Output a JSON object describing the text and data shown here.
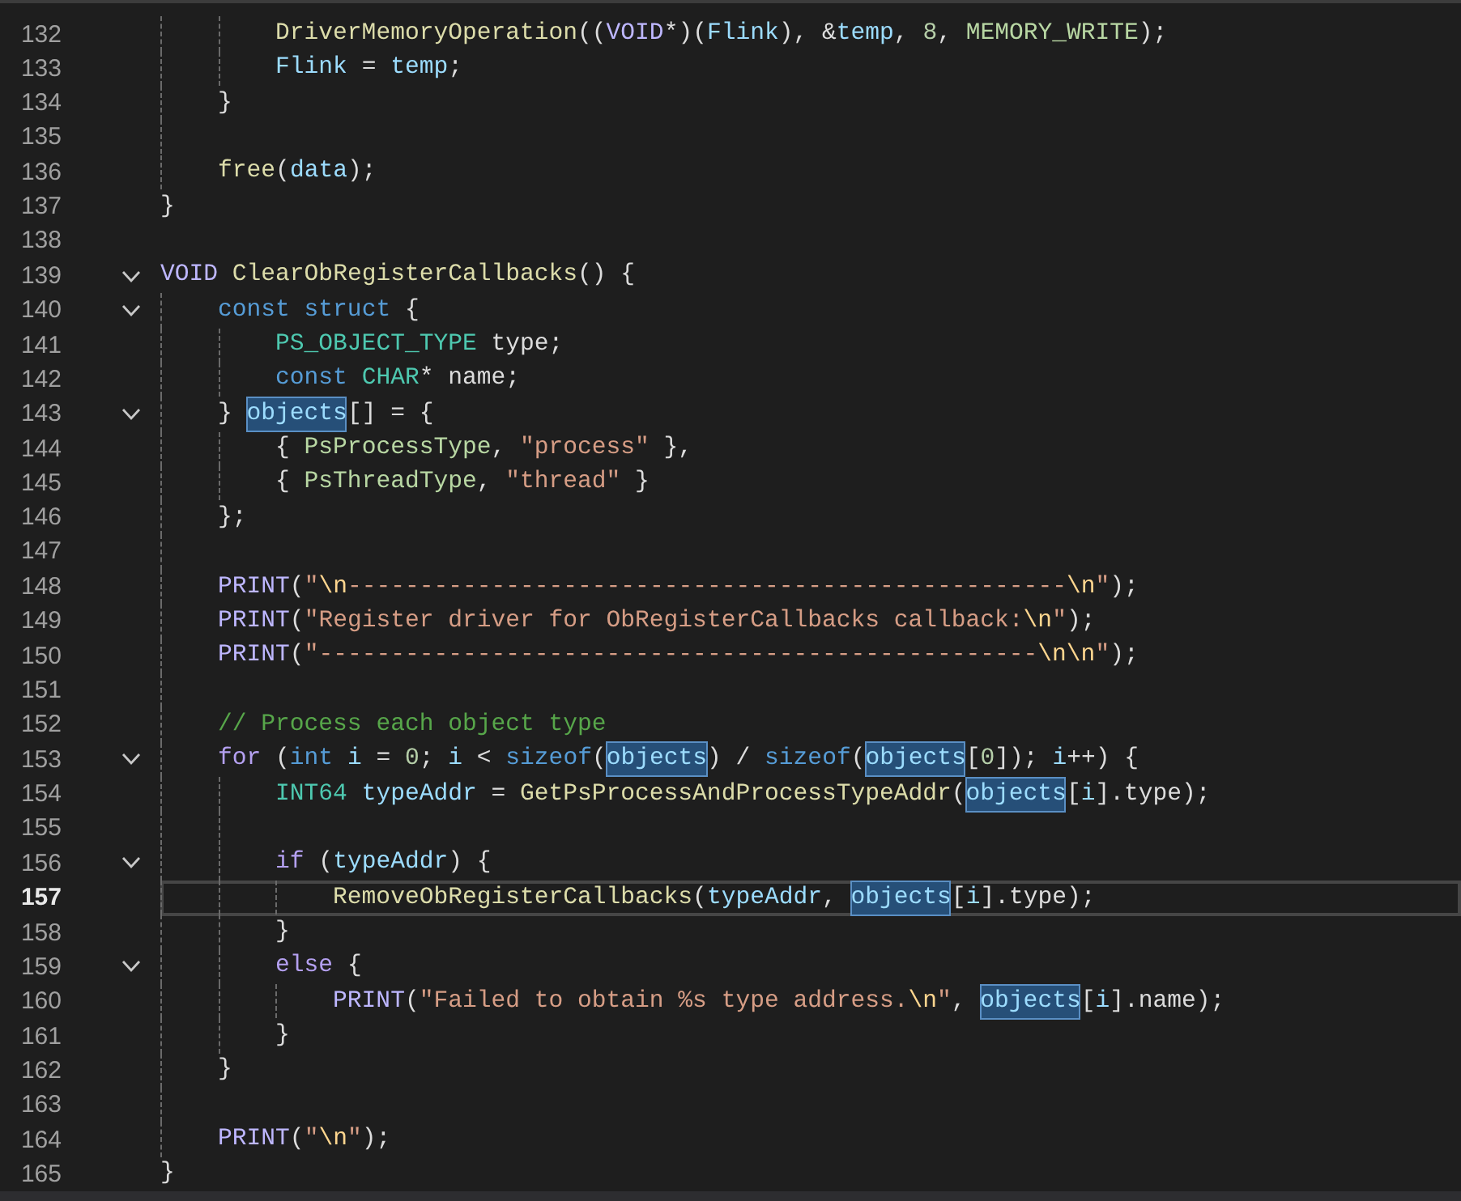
{
  "editor": {
    "lines": [
      {
        "children": [
          {
            "children": [
              {
                "number": "132",
                "fold": false,
                "current": false,
                "tokens": [
                  {
                    "kind": "f",
                    "text": "DriverMemoryOperation"
                  },
                  {
                    "kind": "p",
                    "text": "(("
                  },
                  {
                    "kind": "m",
                    "text": "VOID"
                  },
                  {
                    "kind": "p",
                    "text": "*)("
                  },
                  {
                    "kind": "v",
                    "text": "Flink"
                  },
                  {
                    "kind": "p",
                    "text": "), &"
                  },
                  {
                    "kind": "v",
                    "text": "temp"
                  },
                  {
                    "kind": "p",
                    "text": ", "
                  },
                  {
                    "kind": "n",
                    "text": "8"
                  },
                  {
                    "kind": "p",
                    "text": ", "
                  },
                  {
                    "kind": "en",
                    "text": "MEMORY_WRITE"
                  },
                  {
                    "kind": "p",
                    "text": ");"
                  }
                ]
              },
              {
                "number": "133",
                "fold": false,
                "current": false,
                "tokens": [
                  {
                    "kind": "v",
                    "text": "Flink"
                  },
                  {
                    "kind": "p",
                    "text": " = "
                  },
                  {
                    "kind": "v",
                    "text": "temp"
                  },
                  {
                    "kind": "p",
                    "text": ";"
                  }
                ]
              }
            ]
          },
          {
            "number": "134",
            "fold": false,
            "current": false,
            "tokens": [
              {
                "kind": "p",
                "text": "}"
              }
            ]
          },
          {
            "number": "135",
            "fold": false,
            "current": false
          },
          {
            "number": "136",
            "fold": false,
            "current": false,
            "tokens": [
              {
                "kind": "f",
                "text": "free"
              },
              {
                "kind": "p",
                "text": "("
              },
              {
                "kind": "v",
                "text": "data"
              },
              {
                "kind": "p",
                "text": ");"
              }
            ]
          }
        ]
      },
      {
        "number": "137",
        "fold": false,
        "current": false,
        "tokens": [
          {
            "kind": "p",
            "text": "}"
          }
        ]
      },
      {
        "number": "138",
        "fold": false,
        "current": false
      },
      {
        "number": "139",
        "fold": true,
        "current": false,
        "tokens": [
          {
            "kind": "m",
            "text": "VOID "
          },
          {
            "kind": "f",
            "text": "ClearObRegisterCallbacks"
          },
          {
            "kind": "p",
            "text": "() {"
          }
        ],
        "children": [
          {
            "number": "140",
            "fold": true,
            "current": false,
            "tokens": [
              {
                "kind": "k",
                "text": "const "
              },
              {
                "kind": "k",
                "text": "struct"
              },
              {
                "kind": "p",
                "text": " {"
              }
            ],
            "children": [
              {
                "number": "141",
                "fold": false,
                "current": false,
                "tokens": [
                  {
                    "kind": "t",
                    "text": "PS_OBJECT_TYPE"
                  },
                  {
                    "kind": "p",
                    "text": " type;"
                  }
                ]
              },
              {
                "number": "142",
                "fold": false,
                "current": false,
                "tokens": [
                  {
                    "kind": "k",
                    "text": "const "
                  },
                  {
                    "kind": "t",
                    "text": "CHAR"
                  },
                  {
                    "kind": "p",
                    "text": "* name;"
                  }
                ]
              }
            ]
          },
          {
            "number": "143",
            "fold": true,
            "current": false,
            "tokens": [
              {
                "kind": "p",
                "text": "} "
              },
              {
                "kind": "r",
                "text": "objects"
              },
              {
                "kind": "p",
                "text": "[] = {"
              }
            ],
            "children": [
              {
                "number": "144",
                "fold": false,
                "current": false,
                "tokens": [
                  {
                    "kind": "p",
                    "text": "{ "
                  },
                  {
                    "kind": "en",
                    "text": "PsProcessType"
                  },
                  {
                    "kind": "p",
                    "text": ", "
                  },
                  {
                    "kind": "s",
                    "text": "\"process\""
                  },
                  {
                    "kind": "p",
                    "text": " },"
                  }
                ]
              },
              {
                "number": "145",
                "fold": false,
                "current": false,
                "tokens": [
                  {
                    "kind": "p",
                    "text": "{ "
                  },
                  {
                    "kind": "en",
                    "text": "PsThreadType"
                  },
                  {
                    "kind": "p",
                    "text": ", "
                  },
                  {
                    "kind": "s",
                    "text": "\"thread\""
                  },
                  {
                    "kind": "p",
                    "text": " }"
                  }
                ]
              }
            ]
          },
          {
            "number": "146",
            "fold": false,
            "current": false,
            "tokens": [
              {
                "kind": "p",
                "text": "};"
              }
            ]
          },
          {
            "number": "147",
            "fold": false,
            "current": false
          },
          {
            "number": "148",
            "fold": false,
            "current": false,
            "tokens": [
              {
                "kind": "m",
                "text": "PRINT"
              },
              {
                "kind": "p",
                "text": "("
              },
              {
                "kind": "s",
                "text": "\""
              },
              {
                "kind": "e",
                "text": "\\n"
              },
              {
                "kind": "s",
                "text": "--------------------------------------------------"
              },
              {
                "kind": "e",
                "text": "\\n"
              },
              {
                "kind": "s",
                "text": "\""
              },
              {
                "kind": "p",
                "text": ");"
              }
            ]
          },
          {
            "number": "149",
            "fold": false,
            "current": false,
            "tokens": [
              {
                "kind": "m",
                "text": "PRINT"
              },
              {
                "kind": "p",
                "text": "("
              },
              {
                "kind": "s",
                "text": "\"Register driver for ObRegisterCallbacks callback:"
              },
              {
                "kind": "e",
                "text": "\\n"
              },
              {
                "kind": "s",
                "text": "\""
              },
              {
                "kind": "p",
                "text": ");"
              }
            ]
          },
          {
            "number": "150",
            "fold": false,
            "current": false,
            "tokens": [
              {
                "kind": "m",
                "text": "PRINT"
              },
              {
                "kind": "p",
                "text": "("
              },
              {
                "kind": "s",
                "text": "\"--------------------------------------------------"
              },
              {
                "kind": "e",
                "text": "\\n\\n"
              },
              {
                "kind": "s",
                "text": "\""
              },
              {
                "kind": "p",
                "text": ");"
              }
            ]
          },
          {
            "number": "151",
            "fold": false,
            "current": false
          },
          {
            "number": "152",
            "fold": false,
            "current": false,
            "tokens": [
              {
                "kind": "c",
                "text": "// Process each object type"
              }
            ]
          },
          {
            "number": "153",
            "fold": true,
            "current": false,
            "tokens": [
              {
                "kind": "k2",
                "text": "for"
              },
              {
                "kind": "p",
                "text": " ("
              },
              {
                "kind": "k",
                "text": "int "
              },
              {
                "kind": "v",
                "text": "i"
              },
              {
                "kind": "p",
                "text": " = "
              },
              {
                "kind": "n",
                "text": "0"
              },
              {
                "kind": "p",
                "text": "; "
              },
              {
                "kind": "v",
                "text": "i"
              },
              {
                "kind": "p",
                "text": " < "
              },
              {
                "kind": "k",
                "text": "sizeof"
              },
              {
                "kind": "p",
                "text": "("
              },
              {
                "kind": "r",
                "text": "objects"
              },
              {
                "kind": "p",
                "text": ") / "
              },
              {
                "kind": "k",
                "text": "sizeof"
              },
              {
                "kind": "p",
                "text": "("
              },
              {
                "kind": "r",
                "text": "objects"
              },
              {
                "kind": "p",
                "text": "["
              },
              {
                "kind": "n",
                "text": "0"
              },
              {
                "kind": "p",
                "text": "]); "
              },
              {
                "kind": "v",
                "text": "i"
              },
              {
                "kind": "p",
                "text": "++) {"
              }
            ],
            "children": [
              {
                "number": "154",
                "fold": false,
                "current": false,
                "tokens": [
                  {
                    "kind": "t",
                    "text": "INT64 "
                  },
                  {
                    "kind": "v",
                    "text": "typeAddr"
                  },
                  {
                    "kind": "p",
                    "text": " = "
                  },
                  {
                    "kind": "f",
                    "text": "GetPsProcessAndProcessTypeAddr"
                  },
                  {
                    "kind": "p",
                    "text": "("
                  },
                  {
                    "kind": "r",
                    "text": "objects"
                  },
                  {
                    "kind": "p",
                    "text": "["
                  },
                  {
                    "kind": "v",
                    "text": "i"
                  },
                  {
                    "kind": "p",
                    "text": "].type);"
                  }
                ]
              },
              {
                "number": "155",
                "fold": false,
                "current": false
              },
              {
                "number": "156",
                "fold": true,
                "current": false,
                "tokens": [
                  {
                    "kind": "k2",
                    "text": "if"
                  },
                  {
                    "kind": "p",
                    "text": " ("
                  },
                  {
                    "kind": "v",
                    "text": "typeAddr"
                  },
                  {
                    "kind": "p",
                    "text": ") {"
                  }
                ],
                "children": [
                  {
                    "number": "157",
                    "fold": false,
                    "current": true,
                    "tokens": [
                      {
                        "kind": "f",
                        "text": "RemoveObRegisterCallbacks"
                      },
                      {
                        "kind": "p",
                        "text": "("
                      },
                      {
                        "kind": "v",
                        "text": "typeAddr"
                      },
                      {
                        "kind": "p",
                        "text": ", "
                      },
                      {
                        "kind": "r",
                        "text": "objects"
                      },
                      {
                        "kind": "p",
                        "text": "["
                      },
                      {
                        "kind": "v",
                        "text": "i"
                      },
                      {
                        "kind": "p",
                        "text": "].type);"
                      }
                    ]
                  }
                ]
              },
              {
                "number": "158",
                "fold": false,
                "current": false,
                "tokens": [
                  {
                    "kind": "p",
                    "text": "}"
                  }
                ]
              },
              {
                "number": "159",
                "fold": true,
                "current": false,
                "tokens": [
                  {
                    "kind": "k2",
                    "text": "else"
                  },
                  {
                    "kind": "p",
                    "text": " {"
                  }
                ],
                "children": [
                  {
                    "number": "160",
                    "fold": false,
                    "current": false,
                    "tokens": [
                      {
                        "kind": "m",
                        "text": "PRINT"
                      },
                      {
                        "kind": "p",
                        "text": "("
                      },
                      {
                        "kind": "s",
                        "text": "\"Failed to obtain %s type address."
                      },
                      {
                        "kind": "e",
                        "text": "\\n"
                      },
                      {
                        "kind": "s",
                        "text": "\""
                      },
                      {
                        "kind": "p",
                        "text": ", "
                      },
                      {
                        "kind": "r",
                        "text": "objects"
                      },
                      {
                        "kind": "p",
                        "text": "["
                      },
                      {
                        "kind": "v",
                        "text": "i"
                      },
                      {
                        "kind": "p",
                        "text": "].name);"
                      }
                    ]
                  }
                ]
              },
              {
                "number": "161",
                "fold": false,
                "current": false,
                "tokens": [
                  {
                    "kind": "p",
                    "text": "}"
                  }
                ]
              }
            ]
          },
          {
            "number": "162",
            "fold": false,
            "current": false,
            "tokens": [
              {
                "kind": "p",
                "text": "}"
              }
            ]
          },
          {
            "number": "163",
            "fold": false,
            "current": false
          },
          {
            "number": "164",
            "fold": false,
            "current": false,
            "tokens": [
              {
                "kind": "m",
                "text": "PRINT"
              },
              {
                "kind": "p",
                "text": "("
              },
              {
                "kind": "s",
                "text": "\""
              },
              {
                "kind": "e",
                "text": "\\n"
              },
              {
                "kind": "s",
                "text": "\""
              },
              {
                "kind": "p",
                "text": ");"
              }
            ]
          }
        ]
      },
      {
        "number": "165",
        "fold": false,
        "current": false,
        "tokens": [
          {
            "kind": "p",
            "text": "}"
          }
        ]
      }
    ]
  }
}
